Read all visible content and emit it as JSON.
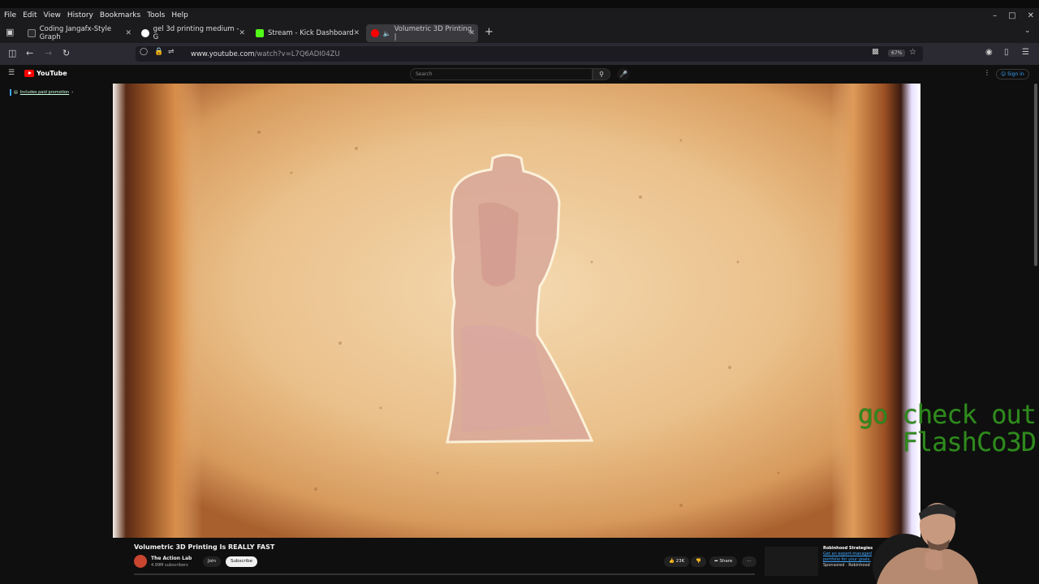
{
  "browser": {
    "menu": [
      "File",
      "Edit",
      "View",
      "History",
      "Bookmarks",
      "Tools",
      "Help"
    ],
    "tabs": [
      {
        "label": "Coding Jangafx-Style Graph",
        "icon": "dev-icon"
      },
      {
        "label": "gel 3d printing medium - G",
        "icon": "google-icon"
      },
      {
        "label": "Stream - Kick Dashboard",
        "icon": "kick-icon"
      },
      {
        "label": "Volumetric 3D Printing |",
        "icon": "youtube-icon"
      }
    ],
    "url_host": "www.youtube.com",
    "url_path": "/watch?v=L7Q6ADI04ZU",
    "zoom": "67%"
  },
  "youtube": {
    "logo": "YouTube",
    "search_placeholder": "Search",
    "sign_in": "Sign in",
    "promo": "Includes paid promotion",
    "video_title": "Volumetric 3D Printing Is REALLY FAST",
    "channel_name": "The Action Lab",
    "channel_subs": "4.99M subscribers",
    "join": "Join",
    "subscribe": "Subscribe",
    "likes": "23K",
    "share": "Share",
    "ad": {
      "title": "Robinhood Strategies",
      "link": "Get an expert-managed portfolio for your goals.",
      "sponsor": "Sponsored · Robinhood"
    }
  },
  "overlay": {
    "line1": "go check out",
    "line2": "FlashCo3D"
  },
  "colors": {
    "overlay_text": "#2f8a1d",
    "youtube_red": "#ff0000",
    "video_bg": "#e6b67e"
  }
}
